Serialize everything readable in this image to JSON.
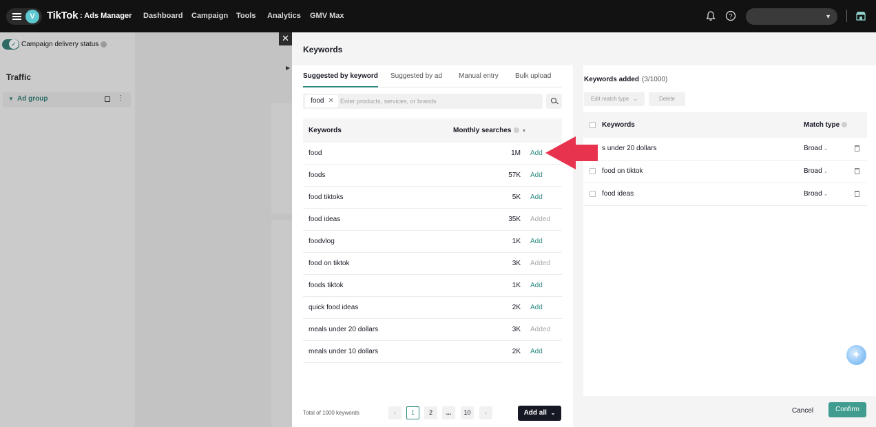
{
  "topbar": {
    "avatar_letter": "V",
    "brand": "TikTok",
    "brand_sub": ": Ads Manager",
    "nav": [
      "Dashboard",
      "Campaign",
      "Tools",
      "Analytics",
      "GMV Max"
    ]
  },
  "background": {
    "campaign_delivery_status": "Campaign delivery status",
    "section_title": "Traffic",
    "ad_group_label": "Ad group",
    "more_glyph": "⋮"
  },
  "drawer": {
    "title": "Keywords",
    "tabs": [
      "Suggested by keyword",
      "Suggested by ad",
      "Manual entry",
      "Bulk upload"
    ],
    "search": {
      "chip": "food",
      "placeholder": "Enter products, services, or brands"
    },
    "table": {
      "col_keywords": "Keywords",
      "col_monthly": "Monthly searches",
      "rows": [
        {
          "keyword": "food",
          "searches": "1M",
          "action": "Add"
        },
        {
          "keyword": "foods",
          "searches": "57K",
          "action": "Add"
        },
        {
          "keyword": "food tiktoks",
          "searches": "5K",
          "action": "Add"
        },
        {
          "keyword": "food ideas",
          "searches": "35K",
          "action": "Added"
        },
        {
          "keyword": "foodvlog",
          "searches": "1K",
          "action": "Add"
        },
        {
          "keyword": "food on tiktok",
          "searches": "3K",
          "action": "Added"
        },
        {
          "keyword": "foods tiktok",
          "searches": "1K",
          "action": "Add"
        },
        {
          "keyword": "quick food ideas",
          "searches": "2K",
          "action": "Add"
        },
        {
          "keyword": "meals under 20 dollars",
          "searches": "3K",
          "action": "Added"
        },
        {
          "keyword": "meals under 10 dollars",
          "searches": "2K",
          "action": "Add"
        }
      ]
    },
    "pagination": {
      "total": "Total of 1000 keywords",
      "pages": [
        "1",
        "2",
        "...",
        "10"
      ],
      "prev": "‹",
      "next": "›"
    },
    "add_all": "Add all",
    "added_panel": {
      "title": "Keywords added",
      "count": "(3/1000)",
      "edit_match_type": "Edit match type",
      "delete": "Delete",
      "col_keywords": "Keywords",
      "col_match": "Match type",
      "rows": [
        {
          "keyword": "s under 20 dollars",
          "match": "Broad"
        },
        {
          "keyword": "food on tiktok",
          "match": "Broad"
        },
        {
          "keyword": "food ideas",
          "match": "Broad"
        }
      ]
    },
    "footer": {
      "cancel": "Cancel",
      "confirm": "Confirm"
    }
  },
  "colors": {
    "accent": "#2c8a80",
    "confirm": "#3f9c8f",
    "annotation_arrow": "#e8334f",
    "topbar": "#121212"
  }
}
